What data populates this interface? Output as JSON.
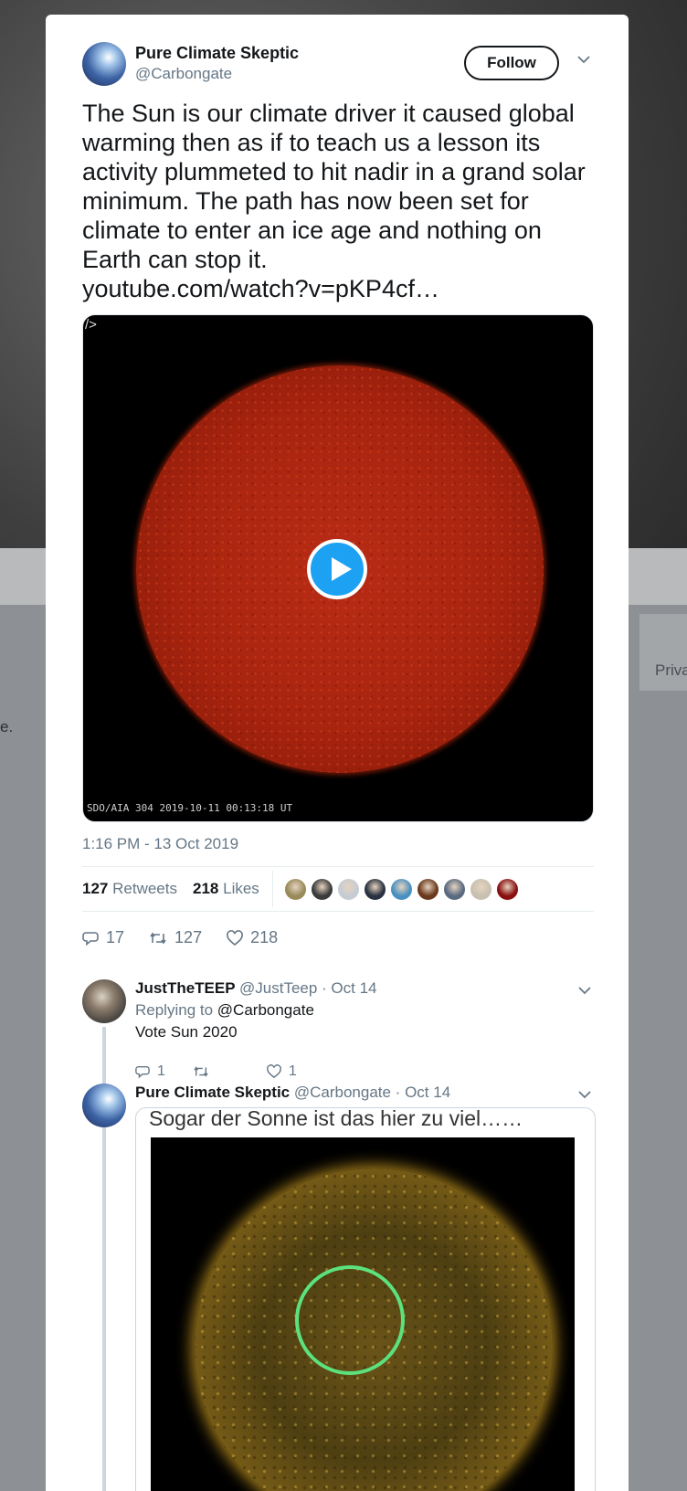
{
  "background": {
    "side_text": "Priva",
    "edge_text": "e."
  },
  "tweet": {
    "author_name": "Pure Climate Skeptic",
    "author_handle": "@Carbongate",
    "follow_label": "Follow",
    "text": "The Sun is our climate driver it caused global warming then as if to teach us a lesson its activity plummeted to hit nadir in a grand solar minimum. The path has now been set for climate to enter an ice age and nothing on Earth can stop it.",
    "link": "youtube.com/watch?v=pKP4cf…",
    "video": {
      "corner_tag": "/>",
      "caption": "SDO/AIA  304     2019-10-11 00:13:18 UT"
    },
    "timestamp": "1:16 PM - 13 Oct 2019",
    "retweets_count": "127",
    "retweets_label": "Retweets",
    "likes_count": "218",
    "likes_label": "Likes",
    "liker_colors": [
      "#9a8a5a",
      "#3b3b3b",
      "#c5ccd3",
      "#2a3140",
      "#4a90c0",
      "#6b3a1c",
      "#5a6a80",
      "#c8c0b0",
      "#8a1010"
    ],
    "actions": {
      "replies": "17",
      "retweets": "127",
      "likes": "218"
    }
  },
  "replies": [
    {
      "name": "JustTheTEEP",
      "meta": "@JustTeep · Oct 14",
      "replying_prefix": "Replying to",
      "replying_to": "@Carbongate",
      "text": "Vote Sun 2020",
      "reply_count": "1",
      "retweet_count": "",
      "like_count": "1"
    },
    {
      "name": "Pure Climate Skeptic",
      "meta": "@Carbongate · Oct 14",
      "card_caption": "Sogar der Sonne ist das hier zu viel……"
    }
  ],
  "colors": {
    "accent": "#1da1f2",
    "text": "#14171a",
    "muted": "#657786",
    "ring": "#5ce27d"
  }
}
